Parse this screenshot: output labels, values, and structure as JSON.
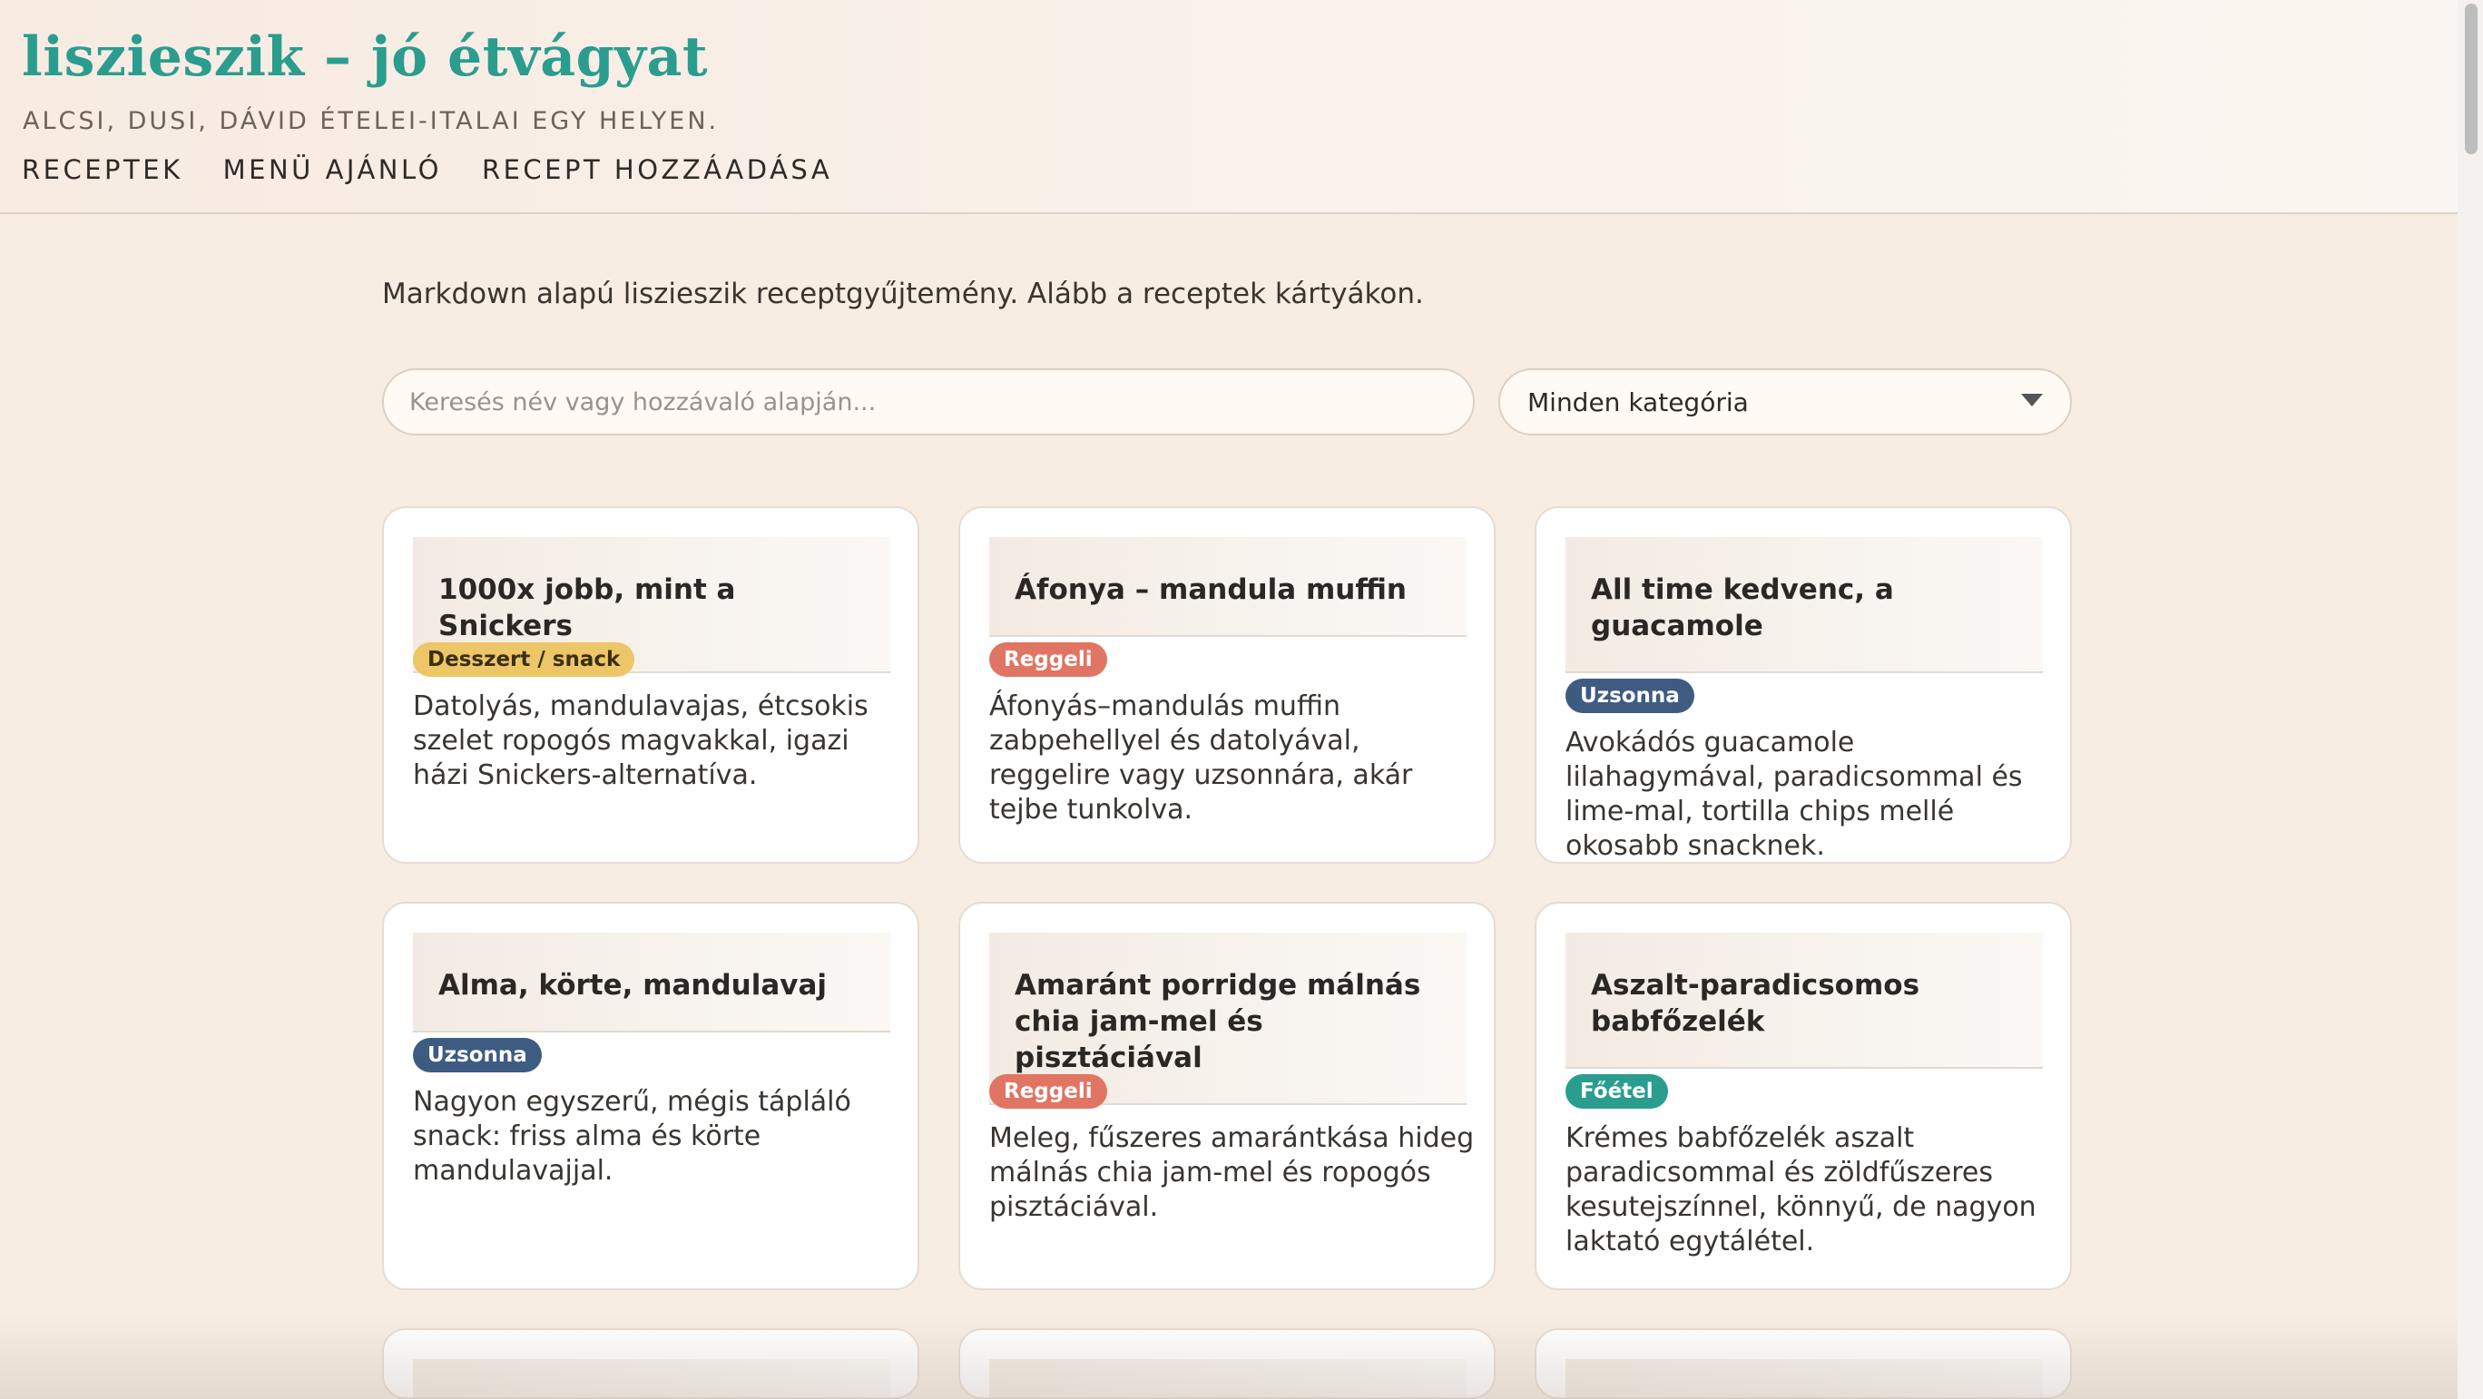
{
  "header": {
    "title": "liszieszik – jó étvágyat",
    "subtitle": "ALCSI, DUSI, DÁVID ÉTELEI-ITALAI EGY HELYEN.",
    "nav": [
      "RECEPTEK",
      "MENÜ AJÁNLÓ",
      "RECEPT HOZZÁADÁSA"
    ]
  },
  "intro": "Markdown alapú liszieszik receptgyűjtemény. Alább a receptek kártyákon.",
  "search": {
    "placeholder": "Keresés név vagy hozzávaló alapján...",
    "value": ""
  },
  "category_select": {
    "selected": "Minden kategória"
  },
  "recipes": [
    {
      "title": "1000x jobb, mint a Snickers",
      "category": "Desszert / snack",
      "description": "Datolyás, mandulavajas, étcsokis szelet ropogós magvakkal, igazi házi Snickers-alternatíva."
    },
    {
      "title": "Áfonya – mandula muffin",
      "category": "Reggeli",
      "description": "Áfonyás–mandulás muffin zabpehellyel és datolyával, reggelire vagy uzsonnára, akár tejbe tunkolva."
    },
    {
      "title": "All time kedvenc, a guacamole",
      "category": "Uzsonna",
      "description": "Avokádós guacamole lilahagymával, paradicsommal és lime-mal, tortilla chips mellé okosabb snacknek."
    },
    {
      "title": "Alma, körte, mandulavaj",
      "category": "Uzsonna",
      "description": "Nagyon egyszerű, mégis tápláló snack: friss alma és körte mandulavajjal."
    },
    {
      "title": "Amaránt porridge málnás chia jam-mel és pisztáciával",
      "category": "Reggeli",
      "description": "Meleg, fűszeres amarántkása hideg málnás chia jam-mel és ropogós pisztáciával."
    },
    {
      "title": "Aszalt-paradicsomos babfőzelék",
      "category": "Főétel",
      "description": "Krémes babfőzelék aszalt paradicsommal és zöldfűszeres kesutejszínnel, könnyű, de nagyon laktató egytálétel."
    }
  ],
  "colors": {
    "accent": "#2a9d8f",
    "dessert_badge": "#edc668",
    "breakfast_badge": "#e07563",
    "snack_badge": "#3e5b82",
    "main_badge": "#2a9d8f"
  }
}
